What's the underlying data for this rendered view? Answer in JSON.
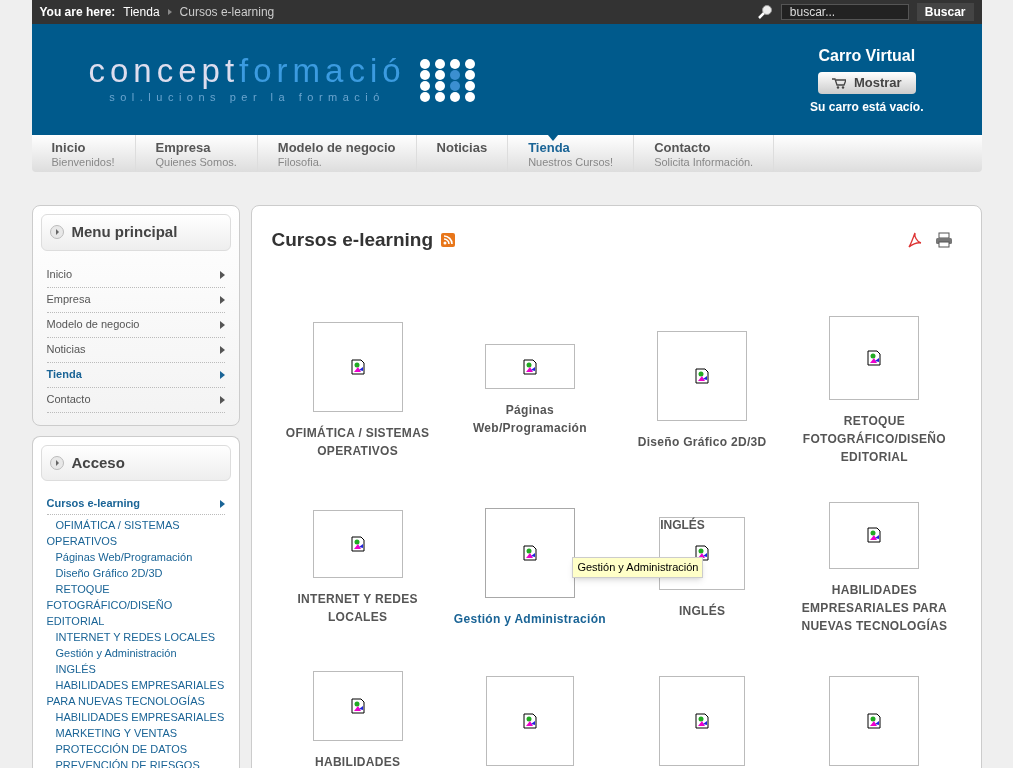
{
  "breadcrumb": {
    "label": "You are here:",
    "items": [
      "Tienda",
      "Cursos e-learning"
    ]
  },
  "search": {
    "placeholder": "buscar...",
    "button": "Buscar"
  },
  "logo": {
    "part1": "concept",
    "part2": "formació",
    "tagline": "sol.lucions per la formació"
  },
  "cart": {
    "title": "Carro Virtual",
    "button": "Mostrar",
    "status": "Su carro está vacío."
  },
  "nav": [
    {
      "title": "Inicio",
      "subtitle": "Bienvenidos!",
      "selected": false
    },
    {
      "title": "Empresa",
      "subtitle": "Quienes Somos.",
      "selected": false
    },
    {
      "title": "Modelo de negocio",
      "subtitle": "Filosofia.",
      "selected": false
    },
    {
      "title": "Noticias",
      "selected": false
    },
    {
      "title": "Tienda",
      "subtitle": "Nuestros Cursos!",
      "selected": true
    },
    {
      "title": "Contacto",
      "subtitle": "Solicita Información.",
      "selected": false
    }
  ],
  "menu_principal": {
    "title": "Menu principal",
    "items": [
      {
        "label": "Inicio",
        "selected": false
      },
      {
        "label": "Empresa",
        "selected": false
      },
      {
        "label": "Modelo de negocio",
        "selected": false
      },
      {
        "label": "Noticias",
        "selected": false
      },
      {
        "label": "Tienda",
        "selected": true
      },
      {
        "label": "Contacto",
        "selected": false
      }
    ]
  },
  "acceso": {
    "title": "Acceso",
    "items": [
      {
        "label": "Cursos e-learning",
        "selected": true,
        "children": [
          "OFIMÁTICA / SISTEMAS OPERATIVOS",
          "Páginas Web/Programación",
          "Diseño Gráfico 2D/3D",
          "RETOQUE FOTOGRÁFICO/DISEÑO EDITORIAL",
          "INTERNET Y REDES LOCALES",
          "Gestión y Administración",
          "INGLÉS",
          "HABILIDADES EMPRESARIALES PARA NUEVAS TECNOLOGÍAS",
          "HABILIDADES EMPRESARIALES",
          "MARKETING Y VENTAS",
          "PROTECCIÓN DE DATOS",
          "PREVENCIÓN DE RIESGOS"
        ]
      }
    ]
  },
  "content": {
    "title": "Cursos e-learning",
    "courses": [
      {
        "name": "OFIMÁTICA / SISTEMAS OPERATIVOS",
        "hovered": false
      },
      {
        "name": "Páginas Web/Programación",
        "hovered": false
      },
      {
        "name": "Diseño Gráfico 2D/3D",
        "hovered": false
      },
      {
        "name": "RETOQUE FOTOGRÁFICO/DISEÑO EDITORIAL",
        "hovered": false
      },
      {
        "name": "INTERNET Y REDES LOCALES",
        "hovered": false
      },
      {
        "name": "Gestión y Administración",
        "hovered": true,
        "tooltip": "Gestión y Administración"
      },
      {
        "name": "INGLÉS",
        "hovered": false,
        "alt_text": "INGLÉS"
      },
      {
        "name": "HABILIDADES EMPRESARIALES PARA NUEVAS TECNOLOGÍAS",
        "hovered": false
      },
      {
        "name": "HABILIDADES",
        "hovered": false
      },
      {
        "hovered": false
      },
      {
        "hovered": false
      },
      {
        "hovered": false
      }
    ]
  }
}
